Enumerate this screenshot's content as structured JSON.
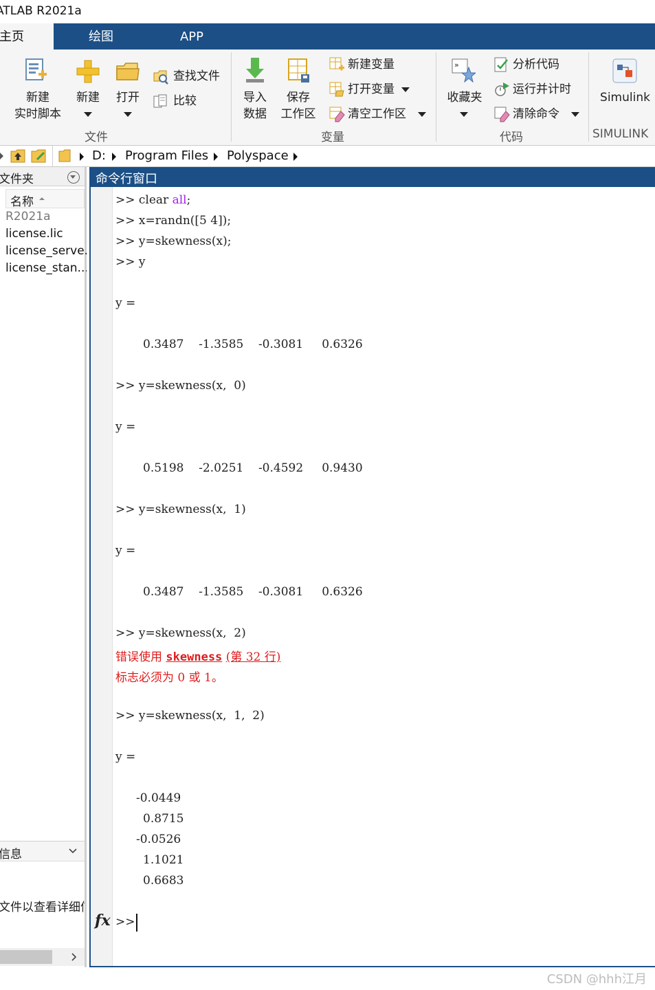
{
  "window": {
    "title": "ATLAB R2021a"
  },
  "tabs": [
    {
      "label": "主页"
    },
    {
      "label": "绘图"
    },
    {
      "label": "APP"
    }
  ],
  "ribbon": {
    "file": {
      "new_live_script": [
        "新建",
        "实时脚本"
      ],
      "new": "新建",
      "open": "打开",
      "find_files": "查找文件",
      "compare": "比较",
      "group_label": "文件"
    },
    "variable": {
      "import_data": [
        "导入",
        "数据"
      ],
      "save_workspace": [
        "保存",
        "工作区"
      ],
      "new_variable": "新建变量",
      "open_variable": "打开变量",
      "clear_workspace": "清空工作区",
      "group_label": "变量"
    },
    "code": {
      "favorites": "收藏夹",
      "analyze_code": "分析代码",
      "run_and_time": "运行并计时",
      "clear_commands": "清除命令",
      "group_label": "代码"
    },
    "simulink": {
      "button": "Simulink",
      "group_label": "SIMULINK"
    }
  },
  "address": {
    "crumbs": [
      "D:",
      "Program Files",
      "Polyspace"
    ]
  },
  "left_panel": {
    "title": "文件夹",
    "column_header": "名称",
    "files": [
      "R2021a",
      "license.lic",
      "license_serve...",
      "license_stan..."
    ],
    "info_title": "信息",
    "info_text": "文件以查看详细信息"
  },
  "command_window": {
    "title": "命令行窗口",
    "prompt": ">>",
    "lines": {
      "l1_cmd": "clear ",
      "l1_kw": "all",
      "l1_end": ";",
      "l2": "x=randn([5 4]);",
      "l3": "y=skewness(x);",
      "l4": "y",
      "l5": "y =",
      "l6": "0.3487    -1.3585    -0.3081     0.6326",
      "l7": "y=skewness(x,  0)",
      "l8": "y =",
      "l9": "0.5198    -2.0251    -0.4592     0.9430",
      "l10": "y=skewness(x,  1)",
      "l11": "y =",
      "l12": "0.3487    -1.3585    -0.3081     0.6326",
      "l13": "y=skewness(x,  2)",
      "err1_pre": "错误使用 ",
      "err1_link": "skewness",
      "err1_post": "(第 32 行)",
      "err2": "标志必须为 0 或 1。",
      "l14": "y=skewness(x,  1,  2)",
      "l15": "y =",
      "v1": "-0.0449",
      "v2": "0.8715",
      "v3": "-0.0526",
      "v4": "1.1021",
      "v5": "0.6683"
    },
    "fx_symbol": "fx"
  },
  "watermark": "CSDN @hhh江月"
}
